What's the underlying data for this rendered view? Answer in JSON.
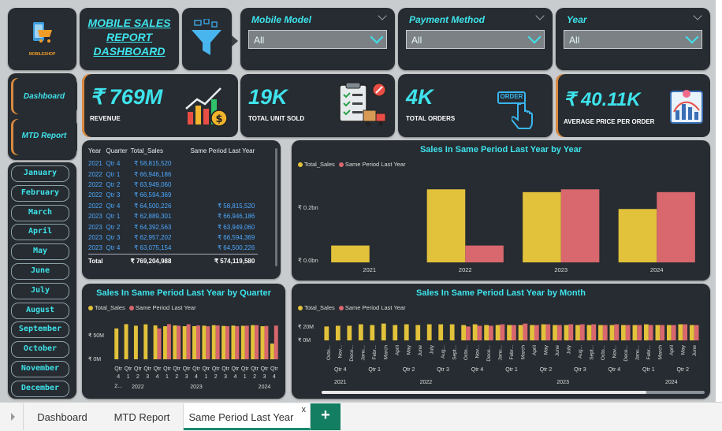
{
  "title": {
    "line1": "MOBILE SALES",
    "line2": "REPORT",
    "line3": "DASHBOARD",
    "logo_text": "MOBILESHOP"
  },
  "filters": [
    {
      "label": "Mobile Model",
      "value": "All"
    },
    {
      "label": "Payment Method",
      "value": "All"
    },
    {
      "label": "Year",
      "value": "All"
    }
  ],
  "nav": {
    "dashboard": "Dashboard",
    "mtd": "MTD Report"
  },
  "kpis": [
    {
      "value": "₹ 769M",
      "label": "REVENUE"
    },
    {
      "value": "19K",
      "label": "TOTAL UNIT SOLD"
    },
    {
      "value": "4K",
      "label": "TOTAL ORDERS",
      "icon_text": "ORDER"
    },
    {
      "value": "₹ 40.11K",
      "label": "AVERAGE PRICE PER ORDER"
    }
  ],
  "months": [
    "January",
    "February",
    "March",
    "April",
    "May",
    "June",
    "July",
    "August",
    "September",
    "October",
    "November",
    "December"
  ],
  "table": {
    "headers": [
      "Year",
      "Quarter",
      "Total_Sales",
      "Same Period Last Year"
    ],
    "rows": [
      [
        "2021",
        "Qtr 4",
        "₹ 58,815,520",
        ""
      ],
      [
        "2022",
        "Qtr 1",
        "₹ 66,946,186",
        ""
      ],
      [
        "2022",
        "Qtr 2",
        "₹ 63,949,060",
        ""
      ],
      [
        "2022",
        "Qtr 3",
        "₹ 66,594,369",
        ""
      ],
      [
        "2022",
        "Qtr 4",
        "₹ 64,500,226",
        "₹ 58,815,520"
      ],
      [
        "2023",
        "Qtr 1",
        "₹ 62,889,301",
        "₹ 66,946,186"
      ],
      [
        "2023",
        "Qtr 2",
        "₹ 64,392,563",
        "₹ 63,949,060"
      ],
      [
        "2023",
        "Qtr 3",
        "₹ 62,957,202",
        "₹ 66,594,369"
      ],
      [
        "2023",
        "Qtr 4",
        "₹ 63,075,154",
        "₹ 64,500,226"
      ]
    ],
    "total": [
      "Total",
      "",
      "₹ 769,204,988",
      "₹ 574,119,580"
    ]
  },
  "colors": {
    "total_sales": "#e2c13b",
    "same_period": "#d8676e",
    "accent": "#3fe3ec",
    "panel": "#262c31"
  },
  "legend": {
    "total_sales": "Total_Sales",
    "same_period": "Same Period Last Year"
  },
  "chart_data": [
    {
      "type": "bar",
      "title": "Sales In Same Period Last Year by Year",
      "categories": [
        "2021",
        "2022",
        "2023",
        "2024"
      ],
      "series": [
        {
          "name": "Total_Sales",
          "values": [
            0.06,
            0.26,
            0.25,
            0.19
          ]
        },
        {
          "name": "Same Period Last Year",
          "values": [
            0,
            0.06,
            0.26,
            0.25
          ]
        }
      ],
      "yticks": [
        "₹ 0.0bn",
        "₹ 0.2bn"
      ],
      "ylim": [
        0,
        0.3
      ]
    },
    {
      "type": "bar",
      "title": "Sales In Same Period Last Year by Quarter",
      "categories": [
        "Qtr 4",
        "Qtr 1",
        "Qtr 2",
        "Qtr 3",
        "Qtr 4",
        "Qtr 1",
        "Qtr 2",
        "Qtr 3",
        "Qtr 4",
        "Qtr 1",
        "Qtr 2",
        "Qtr 3",
        "Qtr 4",
        "Qtr 1",
        "Qtr 2",
        "Qtr 3",
        "Qtr 4"
      ],
      "tick_row1": [
        "Qtr",
        "Qtr",
        "Qtr",
        "Qtr",
        "Qtr",
        "Qtr",
        "Qtr",
        "Qtr",
        "Qtr",
        "Qtr",
        "Qtr",
        "Qtr",
        "Qtr",
        "Qtr",
        "Qtr",
        "Qtr",
        "Qtr"
      ],
      "tick_row2": [
        "4",
        "1",
        "2",
        "3",
        "4",
        "1",
        "2",
        "3",
        "4",
        "1",
        "2",
        "3",
        "4",
        "1",
        "2",
        "3",
        "4"
      ],
      "tick_row3": [
        "2...",
        "",
        "",
        "",
        "",
        "",
        "",
        "",
        "",
        "",
        "",
        "",
        "",
        "",
        "",
        "",
        ""
      ],
      "years": [
        "2022",
        "2023",
        "2024"
      ],
      "series": [
        {
          "name": "Total_Sales",
          "values": [
            58.8,
            66.9,
            63.9,
            66.6,
            64.5,
            62.9,
            64.4,
            63.0,
            63.1,
            64.0,
            65.0,
            63.5,
            64.2,
            63.8,
            65.1,
            63.0,
            30.0
          ]
        },
        {
          "name": "Same Period Last Year",
          "values": [
            0,
            0,
            0,
            0,
            58.8,
            66.9,
            63.9,
            66.6,
            64.5,
            62.9,
            64.4,
            63.0,
            63.1,
            64.0,
            65.0,
            63.5,
            64.2
          ]
        }
      ],
      "yticks": [
        "₹ 0M",
        "₹ 50M"
      ],
      "ylim": [
        0,
        75
      ]
    },
    {
      "type": "bar",
      "title": "Sales In Same Period Last Year by Month",
      "categories": [
        "Octo...",
        "Nov...",
        "Dece...",
        "Janu...",
        "Febr...",
        "March",
        "April",
        "May",
        "June",
        "July",
        "Aug...",
        "Sept...",
        "Octo...",
        "Nov...",
        "Dece...",
        "Janu...",
        "Febr...",
        "March",
        "April",
        "May",
        "June",
        "July",
        "Aug...",
        "Sept...",
        "Octo...",
        "Nov...",
        "Dece...",
        "Janu...",
        "Febr...",
        "March",
        "April",
        "May",
        "June"
      ],
      "quarter_labels": [
        "Qtr 4",
        "Qtr 1",
        "Qtr 2",
        "Qtr 3",
        "Qtr 4",
        "Qtr 1",
        "Qtr 2",
        "Qtr 3",
        "Qtr 4",
        "Qtr 1",
        "Qtr 2"
      ],
      "year_labels": [
        "2021",
        "2022",
        "2023",
        "2024"
      ],
      "series": [
        {
          "name": "Total_Sales",
          "values": [
            19,
            20,
            20,
            22,
            21,
            23,
            21,
            22,
            21,
            22,
            22,
            22,
            21,
            22,
            21,
            21,
            21,
            21,
            21,
            22,
            21,
            21,
            21,
            21,
            21,
            21,
            21,
            21,
            22,
            21,
            21,
            22,
            21
          ]
        },
        {
          "name": "Same Period Last Year",
          "values": [
            0,
            0,
            0,
            0,
            0,
            0,
            0,
            0,
            0,
            0,
            0,
            0,
            19,
            20,
            20,
            22,
            21,
            23,
            21,
            22,
            21,
            22,
            22,
            22,
            21,
            22,
            21,
            21,
            21,
            21,
            21,
            22,
            21
          ]
        }
      ],
      "yticks": [
        "₹ 0M",
        "₹ 20M"
      ],
      "ylim": [
        0,
        28
      ]
    }
  ],
  "tabs": [
    {
      "label": "Dashboard"
    },
    {
      "label": "MTD Report"
    },
    {
      "label": "Same Period Last Year"
    }
  ],
  "tab_close": "x",
  "tab_add": "+"
}
